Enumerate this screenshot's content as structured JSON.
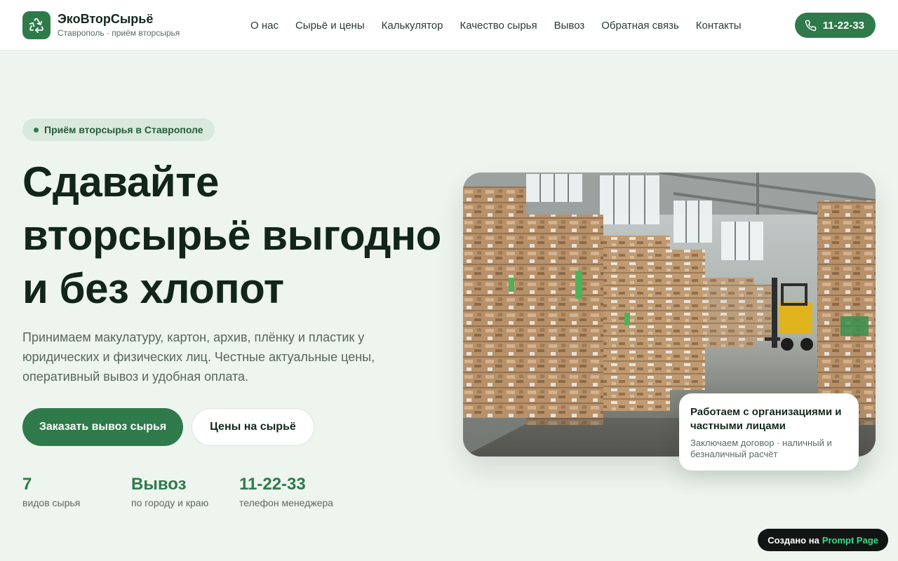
{
  "header": {
    "brand_name": "ЭкоВторСырьё",
    "brand_sub": "Ставрополь · приём вторсырья",
    "nav": [
      "О нас",
      "Сырьё и цены",
      "Калькулятор",
      "Качество сырья",
      "Вывоз",
      "Обратная связь",
      "Контакты"
    ],
    "phone": "11-22-33"
  },
  "hero": {
    "badge": "Приём вторсырья в Ставрополе",
    "title_lines": [
      "Сдавайте",
      "вторсырьё выгодно",
      "и без хлопот"
    ],
    "text": "Принимаем макулатуру, картон, архив, плёнку и пластик у юридических и физических лиц. Честные актуальные цены, оперативный вывоз и удобная оплата.",
    "cta_primary": "Заказать вывоз сырья",
    "cta_secondary": "Цены на сырьё",
    "stats": [
      {
        "value": "7",
        "label": "видов сырья"
      },
      {
        "value": "Вывоз",
        "label": "по городу и краю"
      },
      {
        "value": "11-22-33",
        "label": "телефон менеджера"
      }
    ]
  },
  "info_card": {
    "title": "Работаем с организациями и частными лицами",
    "text": "Заключаем договор · наличный и безналичный расчёт"
  },
  "footer_badge": {
    "prefix": "Создано на",
    "brand": "Prompt Page"
  },
  "colors": {
    "accent": "#2f7a4a",
    "background": "#eef4ee",
    "text": "#14281c"
  },
  "icons": {
    "logo": "recycle-icon",
    "phone": "phone-icon"
  }
}
